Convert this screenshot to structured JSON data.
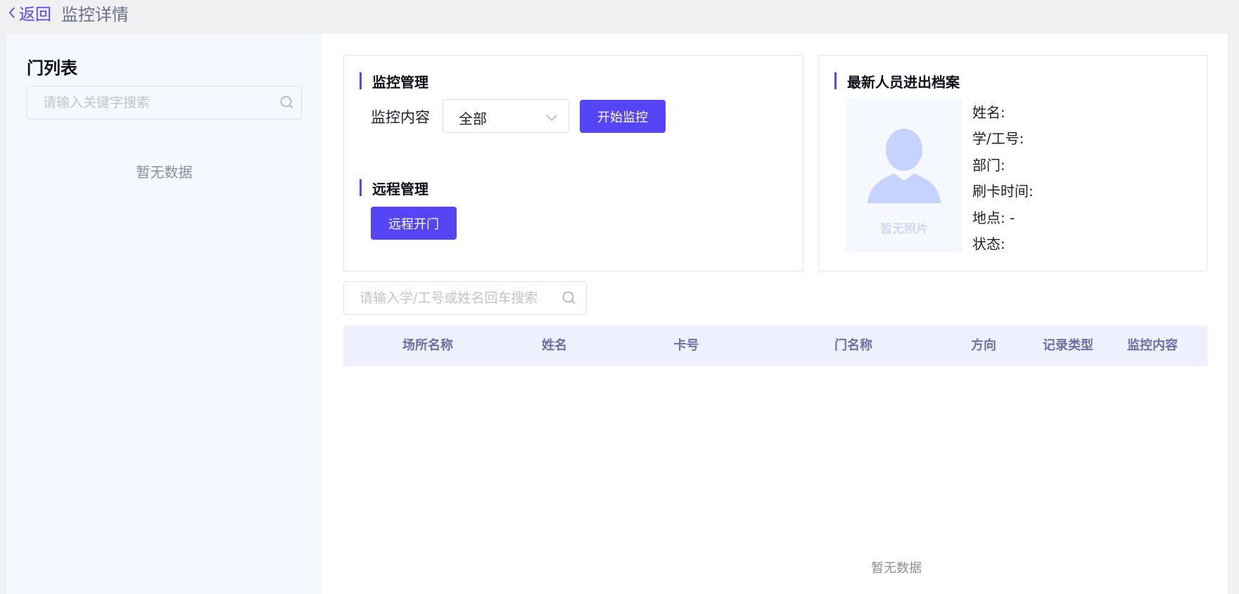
{
  "header": {
    "back_label": "返回",
    "title": "监控详情"
  },
  "sidebar": {
    "title": "门列表",
    "search_placeholder": "请输入关键字搜索",
    "empty_text": "暂无数据"
  },
  "monitor": {
    "section_title": "监控管理",
    "content_label": "监控内容",
    "content_selected": "全部",
    "start_button": "开始监控"
  },
  "remote": {
    "section_title": "远程管理",
    "open_button": "远程开门"
  },
  "record": {
    "section_title": "最新人员进出档案",
    "no_photo": "暂无照片",
    "fields": {
      "name": "姓名:",
      "id": "学/工号:",
      "dept": "部门:",
      "time": "刷卡时间:",
      "location": "地点:",
      "location_value": "-",
      "status": "状态:"
    }
  },
  "table": {
    "search_placeholder": "请输入学/工号或姓名回车搜索",
    "columns": [
      "场所名称",
      "姓名",
      "卡号",
      "门名称",
      "方向",
      "记录类型",
      "监控内容"
    ],
    "empty_text": "暂无数据"
  },
  "colors": {
    "accent": "#5545f5",
    "table_header_bg": "#eef0fd",
    "sidebar_bg": "#f5f8ff"
  }
}
